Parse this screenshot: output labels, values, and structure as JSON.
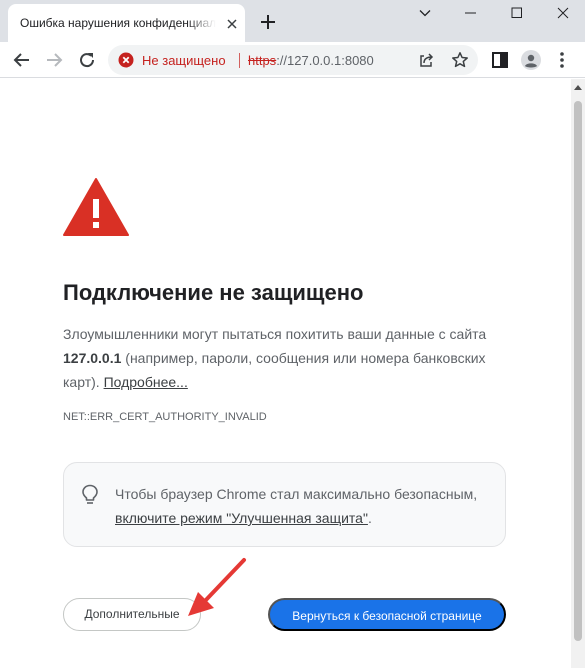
{
  "tab": {
    "title": "Ошибка нарушения конфиденциальности"
  },
  "omnibox": {
    "security_label": "Не защищено",
    "url_scheme": "https",
    "url_rest": "://127.0.0.1:8080"
  },
  "interstitial": {
    "heading": "Подключение не защищено",
    "body_before": "Злоумышленники могут пытаться похитить ваши данные с сайта ",
    "host": "127.0.0.1",
    "body_after": " (например, пароли, сообщения или номера банковских карт). ",
    "learn_more": "Подробнее...",
    "error_code": "NET::ERR_CERT_AUTHORITY_INVALID",
    "enhanced_before": "Чтобы браузер Chrome стал максимально безопасным, ",
    "enhanced_link": "включите режим \"Улучшенная защита\"",
    "enhanced_after": ".",
    "advanced_button": "Дополнительные",
    "back_button": "Вернуться к безопасной странице"
  },
  "colors": {
    "danger": "#d93025",
    "primary": "#1a73e8",
    "annotation": "#e53935"
  },
  "icons": [
    "close-icon",
    "plus-icon",
    "minimize-icon",
    "maximize-icon",
    "window-close-icon",
    "chevron-down-icon",
    "back-arrow-icon",
    "forward-arrow-icon",
    "reload-icon",
    "warning-icon",
    "share-icon",
    "star-icon",
    "side-panel-icon",
    "profile-icon",
    "menu-icon",
    "lightbulb-icon"
  ]
}
